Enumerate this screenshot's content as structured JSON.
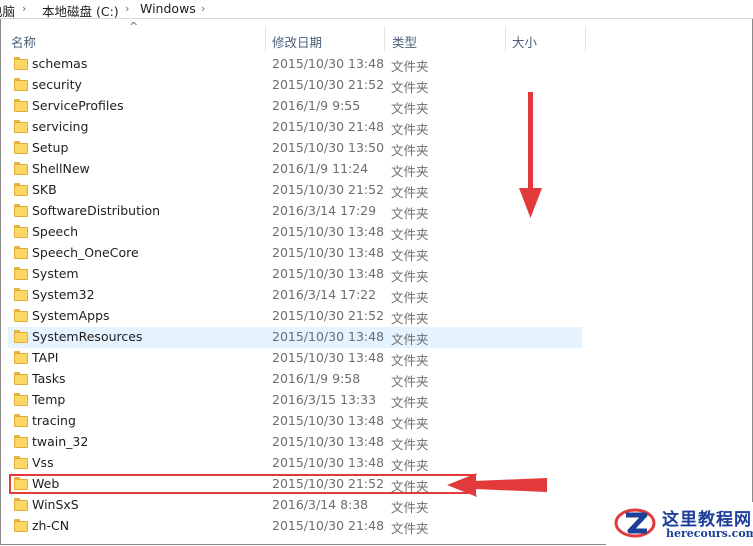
{
  "breadcrumb": {
    "items": [
      "电脑",
      "本地磁盘 (C:)",
      "Windows"
    ]
  },
  "columns": {
    "name": "名称",
    "date": "修改日期",
    "type": "类型",
    "size": "大小"
  },
  "files": [
    {
      "name": "schemas",
      "date": "2015/10/30 13:48",
      "type": "文件夹"
    },
    {
      "name": "security",
      "date": "2015/10/30 21:52",
      "type": "文件夹"
    },
    {
      "name": "ServiceProfiles",
      "date": "2016/1/9 9:55",
      "type": "文件夹"
    },
    {
      "name": "servicing",
      "date": "2015/10/30 21:48",
      "type": "文件夹"
    },
    {
      "name": "Setup",
      "date": "2015/10/30 13:50",
      "type": "文件夹"
    },
    {
      "name": "ShellNew",
      "date": "2016/1/9 11:24",
      "type": "文件夹"
    },
    {
      "name": "SKB",
      "date": "2015/10/30 21:52",
      "type": "文件夹"
    },
    {
      "name": "SoftwareDistribution",
      "date": "2016/3/14 17:29",
      "type": "文件夹"
    },
    {
      "name": "Speech",
      "date": "2015/10/30 13:48",
      "type": "文件夹"
    },
    {
      "name": "Speech_OneCore",
      "date": "2015/10/30 13:48",
      "type": "文件夹"
    },
    {
      "name": "System",
      "date": "2015/10/30 13:48",
      "type": "文件夹"
    },
    {
      "name": "System32",
      "date": "2016/3/14 17:22",
      "type": "文件夹"
    },
    {
      "name": "SystemApps",
      "date": "2015/10/30 21:52",
      "type": "文件夹"
    },
    {
      "name": "SystemResources",
      "date": "2015/10/30 13:48",
      "type": "文件夹",
      "hover": true
    },
    {
      "name": "TAPI",
      "date": "2015/10/30 13:48",
      "type": "文件夹"
    },
    {
      "name": "Tasks",
      "date": "2016/1/9 9:58",
      "type": "文件夹"
    },
    {
      "name": "Temp",
      "date": "2016/3/15 13:33",
      "type": "文件夹"
    },
    {
      "name": "tracing",
      "date": "2015/10/30 13:48",
      "type": "文件夹"
    },
    {
      "name": "twain_32",
      "date": "2015/10/30 13:48",
      "type": "文件夹"
    },
    {
      "name": "Vss",
      "date": "2015/10/30 13:48",
      "type": "文件夹"
    },
    {
      "name": "Web",
      "date": "2015/10/30 21:52",
      "type": "文件夹",
      "highlighted": true
    },
    {
      "name": "WinSxS",
      "date": "2016/3/14 8:38",
      "type": "文件夹"
    },
    {
      "name": "zh-CN",
      "date": "2015/10/30 21:48",
      "type": "文件夹"
    }
  ],
  "annotation_color": "#e23a3a",
  "watermark": {
    "title": "这里教程网",
    "url": "herecours.com"
  }
}
